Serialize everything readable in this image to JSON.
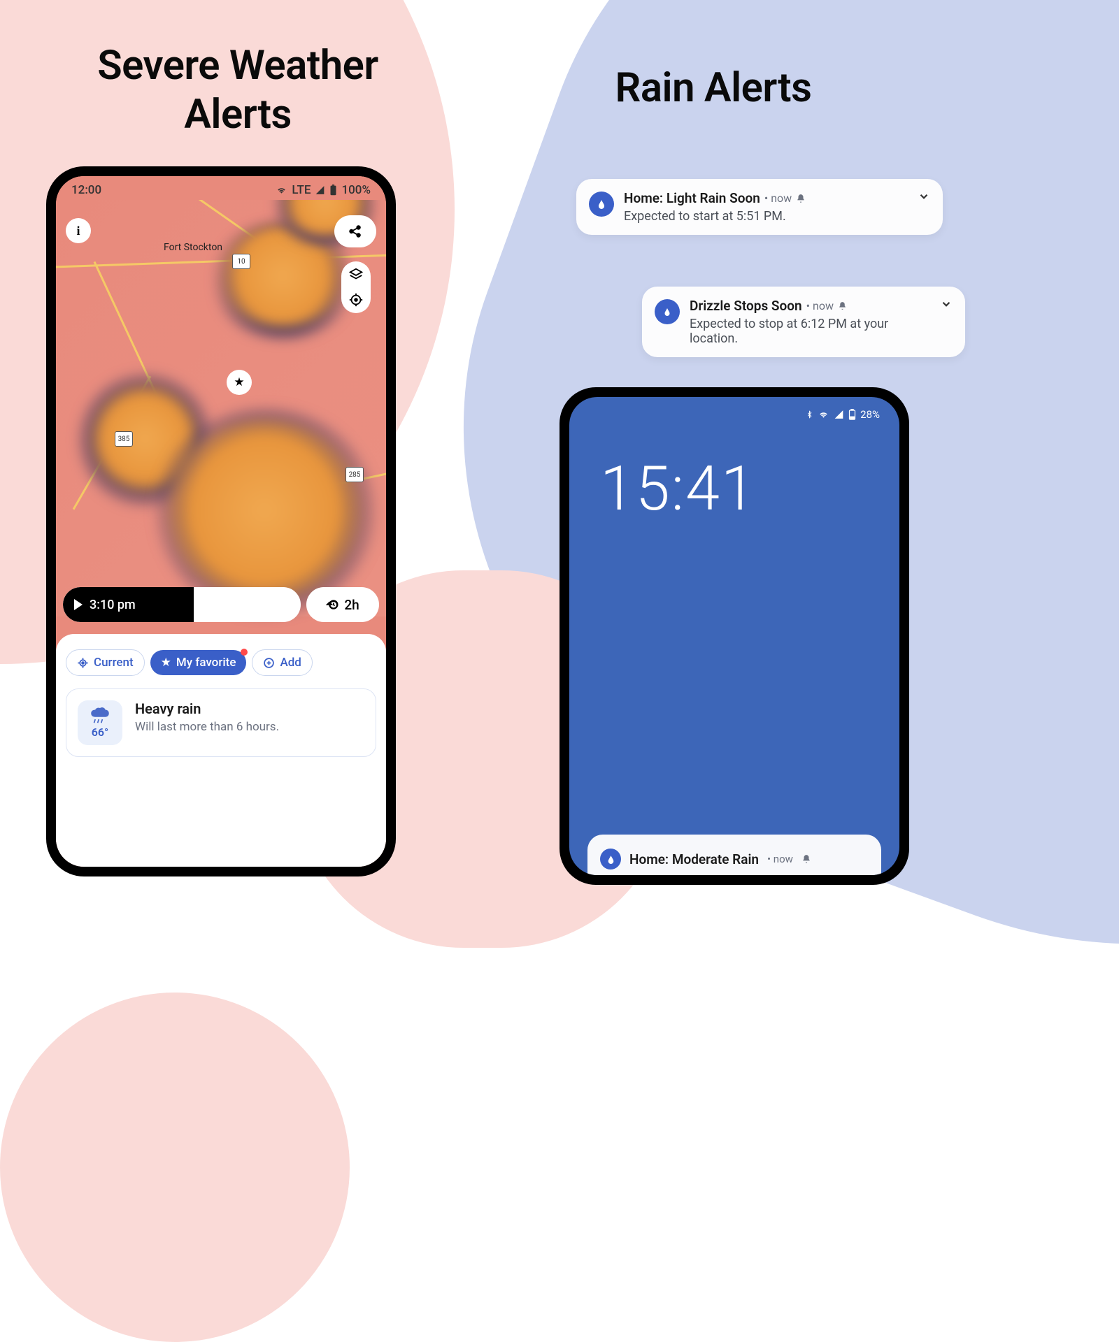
{
  "headings": {
    "left_line1": "Severe Weather",
    "left_line2": "Alerts",
    "right": "Rain Alerts"
  },
  "phone_left": {
    "status": {
      "time": "12:00",
      "network": "LTE",
      "battery": "100%"
    },
    "map": {
      "city": "Fort Stockton",
      "route_1": "10",
      "route_2": "385",
      "route_3": "285"
    },
    "timeline": {
      "time": "3:10 pm",
      "range": "2h"
    },
    "chips": {
      "current": "Current",
      "favorite": "My favorite",
      "add": "Add"
    },
    "weather_card": {
      "temp": "66°",
      "title": "Heavy rain",
      "subtitle": "Will last more than 6 hours."
    }
  },
  "notifications": [
    {
      "title": "Home: Light Rain Soon",
      "meta": "• now",
      "body": "Expected to start at 5:51 PM."
    },
    {
      "title": "Drizzle Stops Soon",
      "meta": "• now",
      "body": "Expected to stop at 6:12 PM at your location."
    }
  ],
  "phone_right": {
    "status": {
      "battery": "28%"
    },
    "clock": "15:41",
    "lock_notif": {
      "title": "Home: Moderate Rain",
      "meta": "• now"
    }
  }
}
